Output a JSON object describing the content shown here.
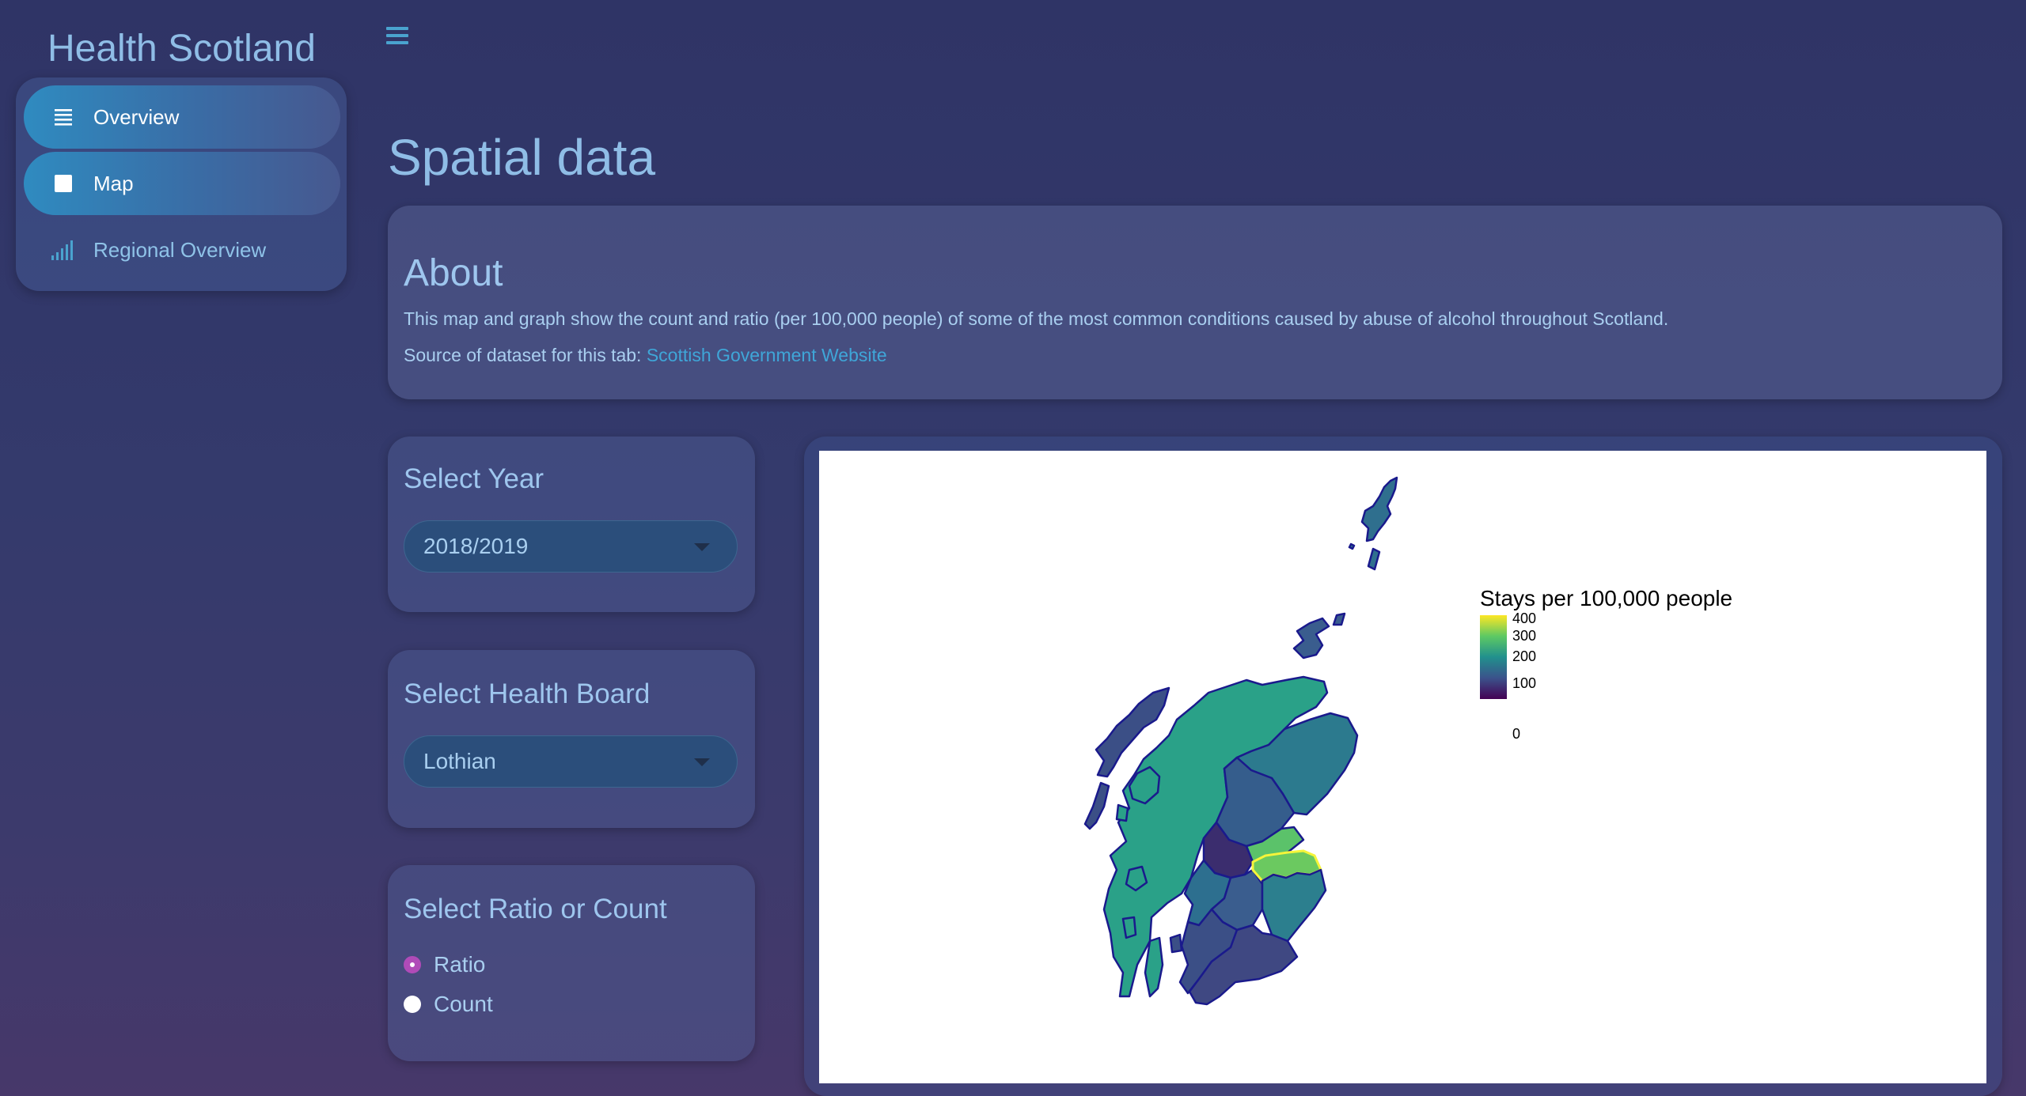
{
  "app": {
    "title": "Health Scotland"
  },
  "sidebar": {
    "items": [
      {
        "label": "Overview",
        "icon": "list-icon",
        "active": true
      },
      {
        "label": "Map",
        "icon": "square-icon",
        "active": true
      },
      {
        "label": "Regional Overview",
        "icon": "signal-bars-icon",
        "active": false
      }
    ]
  },
  "header": {
    "menu_icon": "hamburger-icon"
  },
  "page": {
    "title": "Spatial data"
  },
  "about": {
    "heading": "About",
    "description": "This map and graph show the count and ratio (per 100,000 people) of some of the most common conditions caused by abuse of alcohol throughout Scotland.",
    "source_prefix": "Source of dataset for this tab:",
    "source_link": "Scottish Government Website"
  },
  "controls": {
    "year": {
      "heading": "Select Year",
      "value": "2018/2019"
    },
    "health_board": {
      "heading": "Select Health Board",
      "value": "Lothian"
    },
    "metric": {
      "heading": "Select Ratio or Count",
      "options": [
        {
          "label": "Ratio",
          "selected": true
        },
        {
          "label": "Count",
          "selected": false
        }
      ]
    }
  },
  "map": {
    "legend_title": "Stays per 100,000 people",
    "legend_ticks": [
      "400",
      "300",
      "200",
      "100",
      "0"
    ],
    "highlighted_region": "Lothian",
    "colors": {
      "highlight_stroke": "#f5f53a",
      "region_stroke": "#1a1a8c",
      "accent": "#3fa6d8"
    }
  }
}
